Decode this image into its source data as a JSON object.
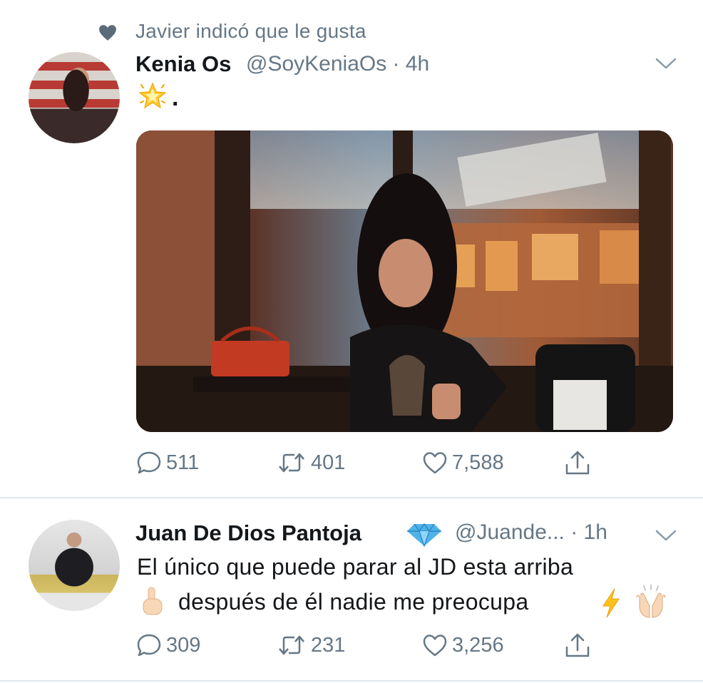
{
  "social_context": {
    "text": "Javier indicó que le gusta",
    "icon": "heart-icon"
  },
  "tweets": [
    {
      "name": "Kenia Os",
      "handle_time": "@SoyKeniaOs · 4h",
      "text": ".",
      "emoji": "glowing-star",
      "media_alt": "photo",
      "actions": {
        "replies": "511",
        "retweets": "401",
        "likes": "7,588"
      }
    },
    {
      "name": "Juan De Dios Pantoja",
      "badge": "gem-stone",
      "handle_time": "@Juande... · 1h",
      "text_line1": "El único que puede parar al JD esta arriba",
      "text_line2": "después de él nadie me preocupa",
      "emojis": [
        "backhand-index-pointing-up",
        "high-voltage",
        "raising-hands"
      ],
      "actions": {
        "replies": "309",
        "retweets": "231",
        "likes": "3,256"
      }
    }
  ],
  "colors": {
    "secondary_text": "#657786",
    "primary_text": "#14171a",
    "divider": "#e1e8ed"
  }
}
